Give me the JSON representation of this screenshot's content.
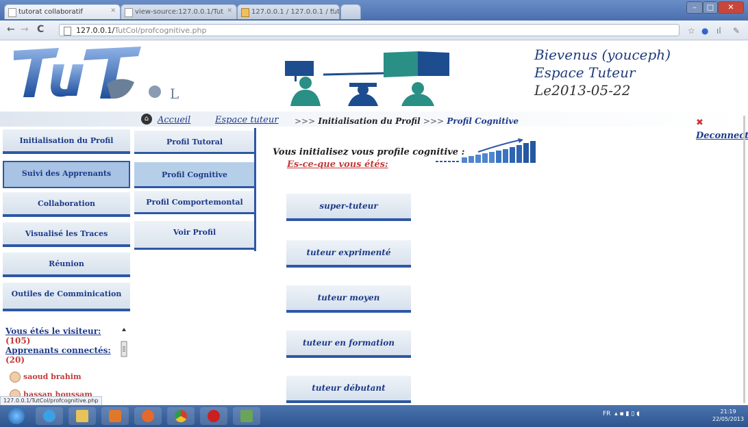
{
  "browser": {
    "tabs": [
      {
        "label": "tutorat collaboratif"
      },
      {
        "label": "view-source:127.0.0.1/Tut"
      },
      {
        "label": "127.0.0.1 / 127.0.0.1 / tutco"
      }
    ],
    "url_host": "127.0.0.1/",
    "url_path": "TutCol/profcognitive.php",
    "status_url": "127.0.0.1/TutCol/profcognitive.php"
  },
  "header": {
    "welcome": "Bievenus (youceph)",
    "space": "Espace Tuteur",
    "date": "Le2013-05-22"
  },
  "nav": {
    "home": "Accueil",
    "tutor_space": "Espace tuteur",
    "breadcrumb_sep1": ">>>",
    "breadcrumb_item1": "Initialisation du Profil",
    "breadcrumb_sep2": ">>>",
    "breadcrumb_item2": "Profil Cognitive",
    "logout": "Deconnection"
  },
  "menu": {
    "items": [
      {
        "label": "Initialisation du Profil"
      },
      {
        "label": "Suivi des Apprenants"
      },
      {
        "label": "Collaboration"
      },
      {
        "label": "Visualisé les Traces"
      },
      {
        "label": "Réunion"
      },
      {
        "label": "Outiles de Comminication"
      }
    ]
  },
  "submenu": {
    "items": [
      {
        "label": "Profil Tutoral"
      },
      {
        "label": "Profil Cognitive"
      },
      {
        "label": "Profil Comportemontal"
      },
      {
        "label": "Voir Profil"
      }
    ]
  },
  "main": {
    "intro": "Vous initialisez vous profile cognitive :",
    "question": "Es-ce-que vous étés:",
    "options": [
      {
        "label": "super-tuteur"
      },
      {
        "label": "tuteur exprimenté"
      },
      {
        "label": "tuteur moyen"
      },
      {
        "label": "tuteur en formation"
      },
      {
        "label": "tuteur débutant"
      }
    ]
  },
  "visitors": {
    "visitor_label": "Vous étés le visiteur:",
    "visitor_count": "(105)",
    "connected_label": "Apprenants connectés:",
    "connected_count": "(20)",
    "users": [
      {
        "name": "saoud brahim"
      },
      {
        "name": "hassan houssam"
      }
    ]
  },
  "taskbar": {
    "lang": "FR",
    "time": "21:19",
    "date": "22/05/2013"
  }
}
